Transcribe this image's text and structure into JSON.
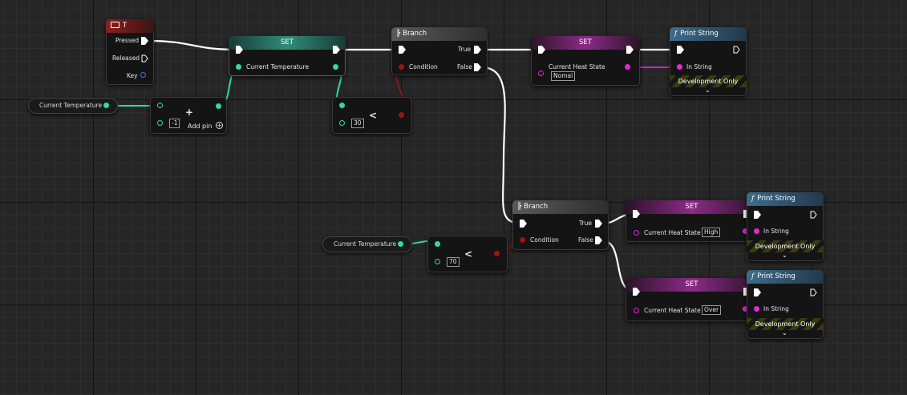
{
  "colors": {
    "exec_wire": "#ffffff",
    "float_wire": "#2ddca8",
    "string_wire": "#e526d8",
    "bool_wire": "#9c1414"
  },
  "event_t": {
    "title": "T",
    "pins": {
      "pressed": "Pressed",
      "released": "Released",
      "key": "Key"
    }
  },
  "get_current_temperature_1": {
    "label": "Current Temperature"
  },
  "get_current_temperature_2": {
    "label": "Current Temperature"
  },
  "add_node": {
    "operator": "+",
    "value": "-1",
    "add_pin_label": "Add pin"
  },
  "set_current_temperature": {
    "title": "SET",
    "var_label": "Current Temperature"
  },
  "less_1": {
    "operator": "<",
    "value": "30"
  },
  "less_2": {
    "operator": "<",
    "value": "70"
  },
  "branch_1": {
    "title": "Branch",
    "true_label": "True",
    "false_label": "False",
    "condition_label": "Condition"
  },
  "branch_2": {
    "title": "Branch",
    "true_label": "True",
    "false_label": "False",
    "condition_label": "Condition"
  },
  "set_heat_normal": {
    "title": "SET",
    "var_label": "Current Heat State",
    "value": "Nomal"
  },
  "set_heat_high": {
    "title": "SET",
    "var_label": "Current Heat State",
    "value": "High"
  },
  "set_heat_over": {
    "title": "SET",
    "var_label": "Current Heat State",
    "value": "Over"
  },
  "print_1": {
    "title": "Print String",
    "in_string_label": "In String",
    "dev_label": "Development Only"
  },
  "print_2": {
    "title": "Print String",
    "in_string_label": "In String",
    "dev_label": "Development Only"
  },
  "print_3": {
    "title": "Print String",
    "in_string_label": "In String",
    "dev_label": "Development Only"
  }
}
